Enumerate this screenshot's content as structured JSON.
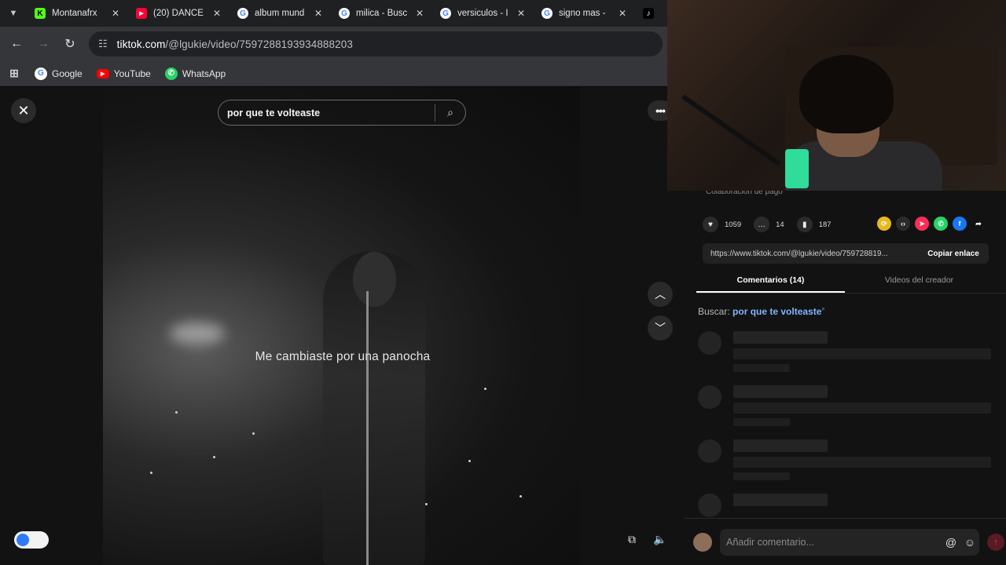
{
  "browser": {
    "tabs": [
      {
        "title": "Montanafrx",
        "favicon": "kick-icon"
      },
      {
        "title": "(20) DANCE",
        "favicon": "youtube-icon"
      },
      {
        "title": "album mund",
        "favicon": "google-icon"
      },
      {
        "title": "milica - Busc",
        "favicon": "google-icon"
      },
      {
        "title": "versiculos - I",
        "favicon": "google-icon"
      },
      {
        "title": "signo mas -",
        "favicon": "google-icon"
      },
      {
        "title": "",
        "favicon": "tiktok-icon"
      }
    ],
    "url_domain": "tiktok.com",
    "url_path": "/@lgukie/video/7597288193934888203",
    "bookmarks": [
      {
        "label": "Google",
        "icon": "google-icon"
      },
      {
        "label": "YouTube",
        "icon": "youtube-icon"
      },
      {
        "label": "WhatsApp",
        "icon": "whatsapp-icon"
      }
    ]
  },
  "viewer": {
    "search_query": "por que te volteaste",
    "caption": "Me cambiaste por una panocha"
  },
  "panel": {
    "collab_text": "Colaboración de pago",
    "likes": "1059",
    "comments": "14",
    "saves": "187",
    "share_link": "https://www.tiktok.com/@lgukie/video/759728819...",
    "copy_label": "Copiar enlace",
    "tab_comments": "Comentarios (14)",
    "tab_creator": "Videos del creador",
    "search_label": "Buscar:",
    "search_term": "por que te volteaste",
    "comment_placeholder": "Añadir comentario..."
  },
  "colors": {
    "accent_link": "#7fb5ff",
    "post_button": "#5a1a24",
    "toggle_knob": "#2f7bf5"
  }
}
